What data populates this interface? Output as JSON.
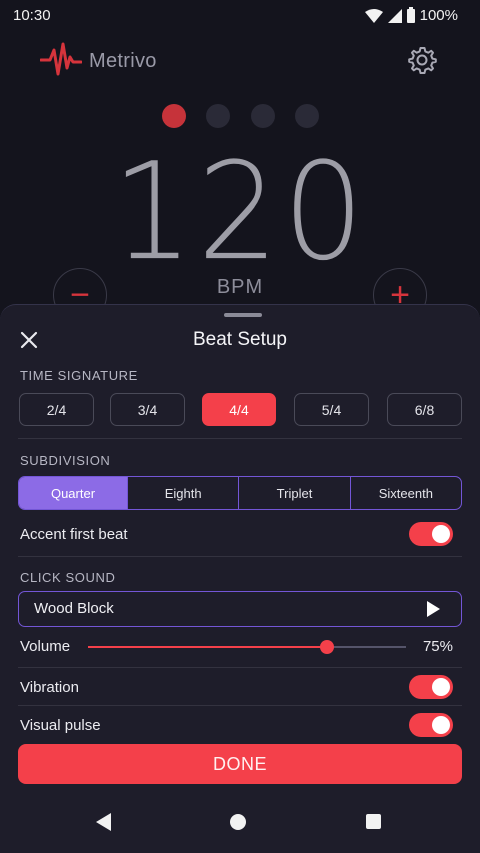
{
  "status": {
    "time": "10:30",
    "battery": "100%"
  },
  "header": {
    "app_name": "Metrivo"
  },
  "beats": {
    "count": 4,
    "active_index": 0
  },
  "tempo": {
    "value": "120",
    "unit": "BPM",
    "decrement": "−",
    "increment": "+"
  },
  "sheet": {
    "title": "Beat Setup",
    "time_signature": {
      "label": "TIME SIGNATURE",
      "options": [
        "2/4",
        "3/4",
        "4/4",
        "5/4",
        "6/8"
      ],
      "selected": "4/4"
    },
    "subdivision": {
      "label": "SUBDIVISION",
      "options": [
        "Quarter",
        "Eighth",
        "Triplet",
        "Sixteenth"
      ],
      "selected": "Quarter"
    },
    "accent_first_beat": {
      "label": "Accent first beat",
      "on": true
    },
    "click_sound": {
      "label": "CLICK SOUND",
      "value": "Wood Block"
    },
    "volume": {
      "label": "Volume",
      "value": "75%",
      "fraction": 0.75
    },
    "vibration": {
      "label": "Vibration",
      "on": true
    },
    "visual_pulse": {
      "label": "Visual pulse",
      "on": true
    },
    "done_label": "DONE"
  },
  "colors": {
    "accent": "#f4404a",
    "purple": "#8c6be6",
    "background": "#14141d",
    "sheet": "#1e1d2a"
  }
}
